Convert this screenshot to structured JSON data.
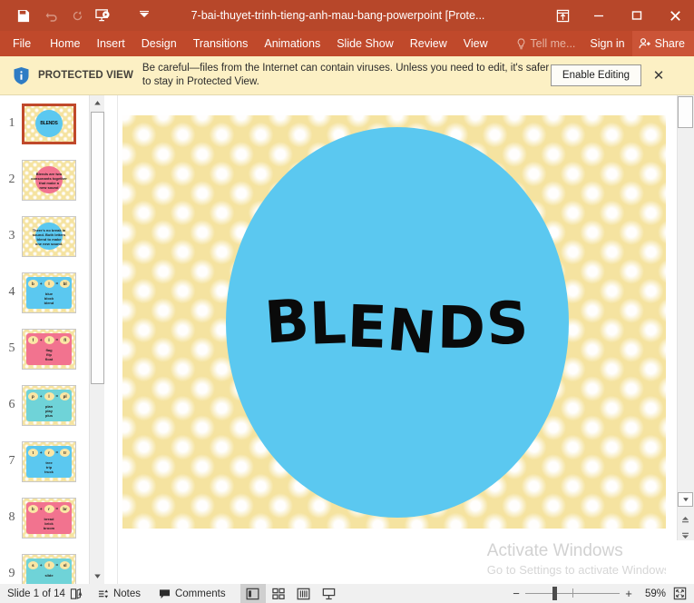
{
  "window": {
    "title": "7-bai-thuyet-trinh-tieng-anh-mau-bang-powerpoint [Prote...",
    "accent_color": "#B7472A",
    "tab_strip_color": "#C0492B",
    "quick_access": [
      {
        "name": "save-button",
        "label": "Save",
        "icon": "save-icon",
        "enabled": true
      },
      {
        "name": "undo-button",
        "label": "Undo",
        "icon": "undo-icon",
        "enabled": false
      },
      {
        "name": "redo-button",
        "label": "Redo",
        "icon": "redo-icon",
        "enabled": false
      },
      {
        "name": "start-presentation-button",
        "label": "Start From Beginning",
        "icon": "presentation-icon",
        "enabled": true
      },
      {
        "name": "customize-qat-button",
        "label": "Customize Quick Access Toolbar",
        "icon": "chevron-down-icon",
        "enabled": true
      }
    ],
    "controls": [
      {
        "name": "ribbon-display-options-button",
        "label": "Ribbon Display Options",
        "icon": "ribbon-options-icon"
      },
      {
        "name": "minimize-button",
        "label": "Minimize",
        "icon": "minimize-icon"
      },
      {
        "name": "maximize-button",
        "label": "Restore Down",
        "icon": "maximize-icon"
      },
      {
        "name": "close-button",
        "label": "Close",
        "icon": "close-icon"
      }
    ]
  },
  "ribbon": {
    "tabs": [
      {
        "label": "File",
        "name": "tab-file"
      },
      {
        "label": "Home",
        "name": "tab-home"
      },
      {
        "label": "Insert",
        "name": "tab-insert"
      },
      {
        "label": "Design",
        "name": "tab-design"
      },
      {
        "label": "Transitions",
        "name": "tab-transitions"
      },
      {
        "label": "Animations",
        "name": "tab-animations"
      },
      {
        "label": "Slide Show",
        "name": "tab-slide-show"
      },
      {
        "label": "Review",
        "name": "tab-review"
      },
      {
        "label": "View",
        "name": "tab-view"
      }
    ],
    "tell_me": "Tell me...",
    "sign_in": "Sign in",
    "share": "Share"
  },
  "protected_view": {
    "label": "PROTECTED VIEW",
    "message": "Be careful—files from the Internet can contain viruses. Unless you need to edit, it's safer to stay in Protected View.",
    "enable_button": "Enable Editing",
    "close": "✕",
    "background_color": "#FCF0C4"
  },
  "slides_panel": {
    "thumbnails": [
      {
        "number": "1",
        "selected": true,
        "style": "title",
        "bg": "#F5E3A0",
        "circle": "#5BC8F0",
        "title": "BLENDS",
        "words": []
      },
      {
        "number": "2",
        "selected": false,
        "style": "circle",
        "bg": "#F5E3A0",
        "circle": "#F2738F",
        "title": "",
        "words": [
          "Blends are two",
          "consonants together",
          "that make a",
          "new sound"
        ]
      },
      {
        "number": "3",
        "selected": false,
        "style": "circle",
        "bg": "#F5E3A0",
        "circle": "#5BC8F0",
        "title": "",
        "words": [
          "There's no break in",
          "sound. Both letters",
          "blend to make",
          "one new sound."
        ]
      },
      {
        "number": "4",
        "selected": false,
        "style": "blend",
        "bg": "#F5E3A0",
        "blob": "#5BC8F0",
        "letters": [
          "b",
          "l",
          "bl"
        ],
        "words": [
          "blue",
          "block",
          "blend"
        ]
      },
      {
        "number": "5",
        "selected": false,
        "style": "blend",
        "bg": "#F5E3A0",
        "blob": "#F2738F",
        "letters": [
          "f",
          "l",
          "fl"
        ],
        "words": [
          "flag",
          "flip",
          "float"
        ]
      },
      {
        "number": "6",
        "selected": false,
        "style": "blend",
        "bg": "#F5E3A0",
        "blob": "#6FD3D8",
        "letters": [
          "p",
          "l",
          "pl"
        ],
        "words": [
          "plan",
          "play",
          "plus"
        ]
      },
      {
        "number": "7",
        "selected": false,
        "style": "blend",
        "bg": "#F5E3A0",
        "blob": "#5BC8F0",
        "letters": [
          "t",
          "r",
          "tr"
        ],
        "words": [
          "tree",
          "trip",
          "truck"
        ]
      },
      {
        "number": "8",
        "selected": false,
        "style": "blend",
        "bg": "#F5E3A0",
        "blob": "#F2738F",
        "letters": [
          "b",
          "r",
          "br"
        ],
        "words": [
          "bread",
          "brick",
          "broom"
        ]
      },
      {
        "number": "9",
        "selected": false,
        "style": "blend",
        "bg": "#F5E3A0",
        "blob": "#6FD3D8",
        "letters": [
          "s",
          "l",
          "sl"
        ],
        "words": [
          "slide"
        ]
      }
    ],
    "scroll_up": "▲",
    "scroll_down": "▼"
  },
  "slide_view": {
    "background_color": "#F5E3A0",
    "circle_color": "#5BC8F0",
    "title": "BLENDS",
    "title_color": "#0A0A0A",
    "dot_color": "#FFFFFF"
  },
  "scrollbar": {
    "scroll_down": "▼",
    "previous_slide": "▴",
    "next_slide": "▾"
  },
  "watermark": {
    "line1": "Activate Windows",
    "line2": "Go to Settings to activate Windows."
  },
  "status_bar": {
    "slide_counter": "Slide 1 of 14",
    "accessibility_icon": "spell-check-icon",
    "notes": "Notes",
    "comments": "Comments",
    "views": [
      {
        "name": "view-normal",
        "label": "Normal",
        "icon": "normal-view-icon",
        "active": true
      },
      {
        "name": "view-slide-sorter",
        "label": "Slide Sorter",
        "icon": "slide-sorter-icon",
        "active": false
      },
      {
        "name": "view-reading",
        "label": "Reading View",
        "icon": "reading-view-icon",
        "active": false
      },
      {
        "name": "view-slide-show",
        "label": "Slide Show",
        "icon": "slide-show-icon",
        "active": false
      }
    ],
    "zoom_out": "−",
    "zoom_in": "+",
    "zoom_level": "59%",
    "fit_to_window": "fit-slide-icon"
  }
}
